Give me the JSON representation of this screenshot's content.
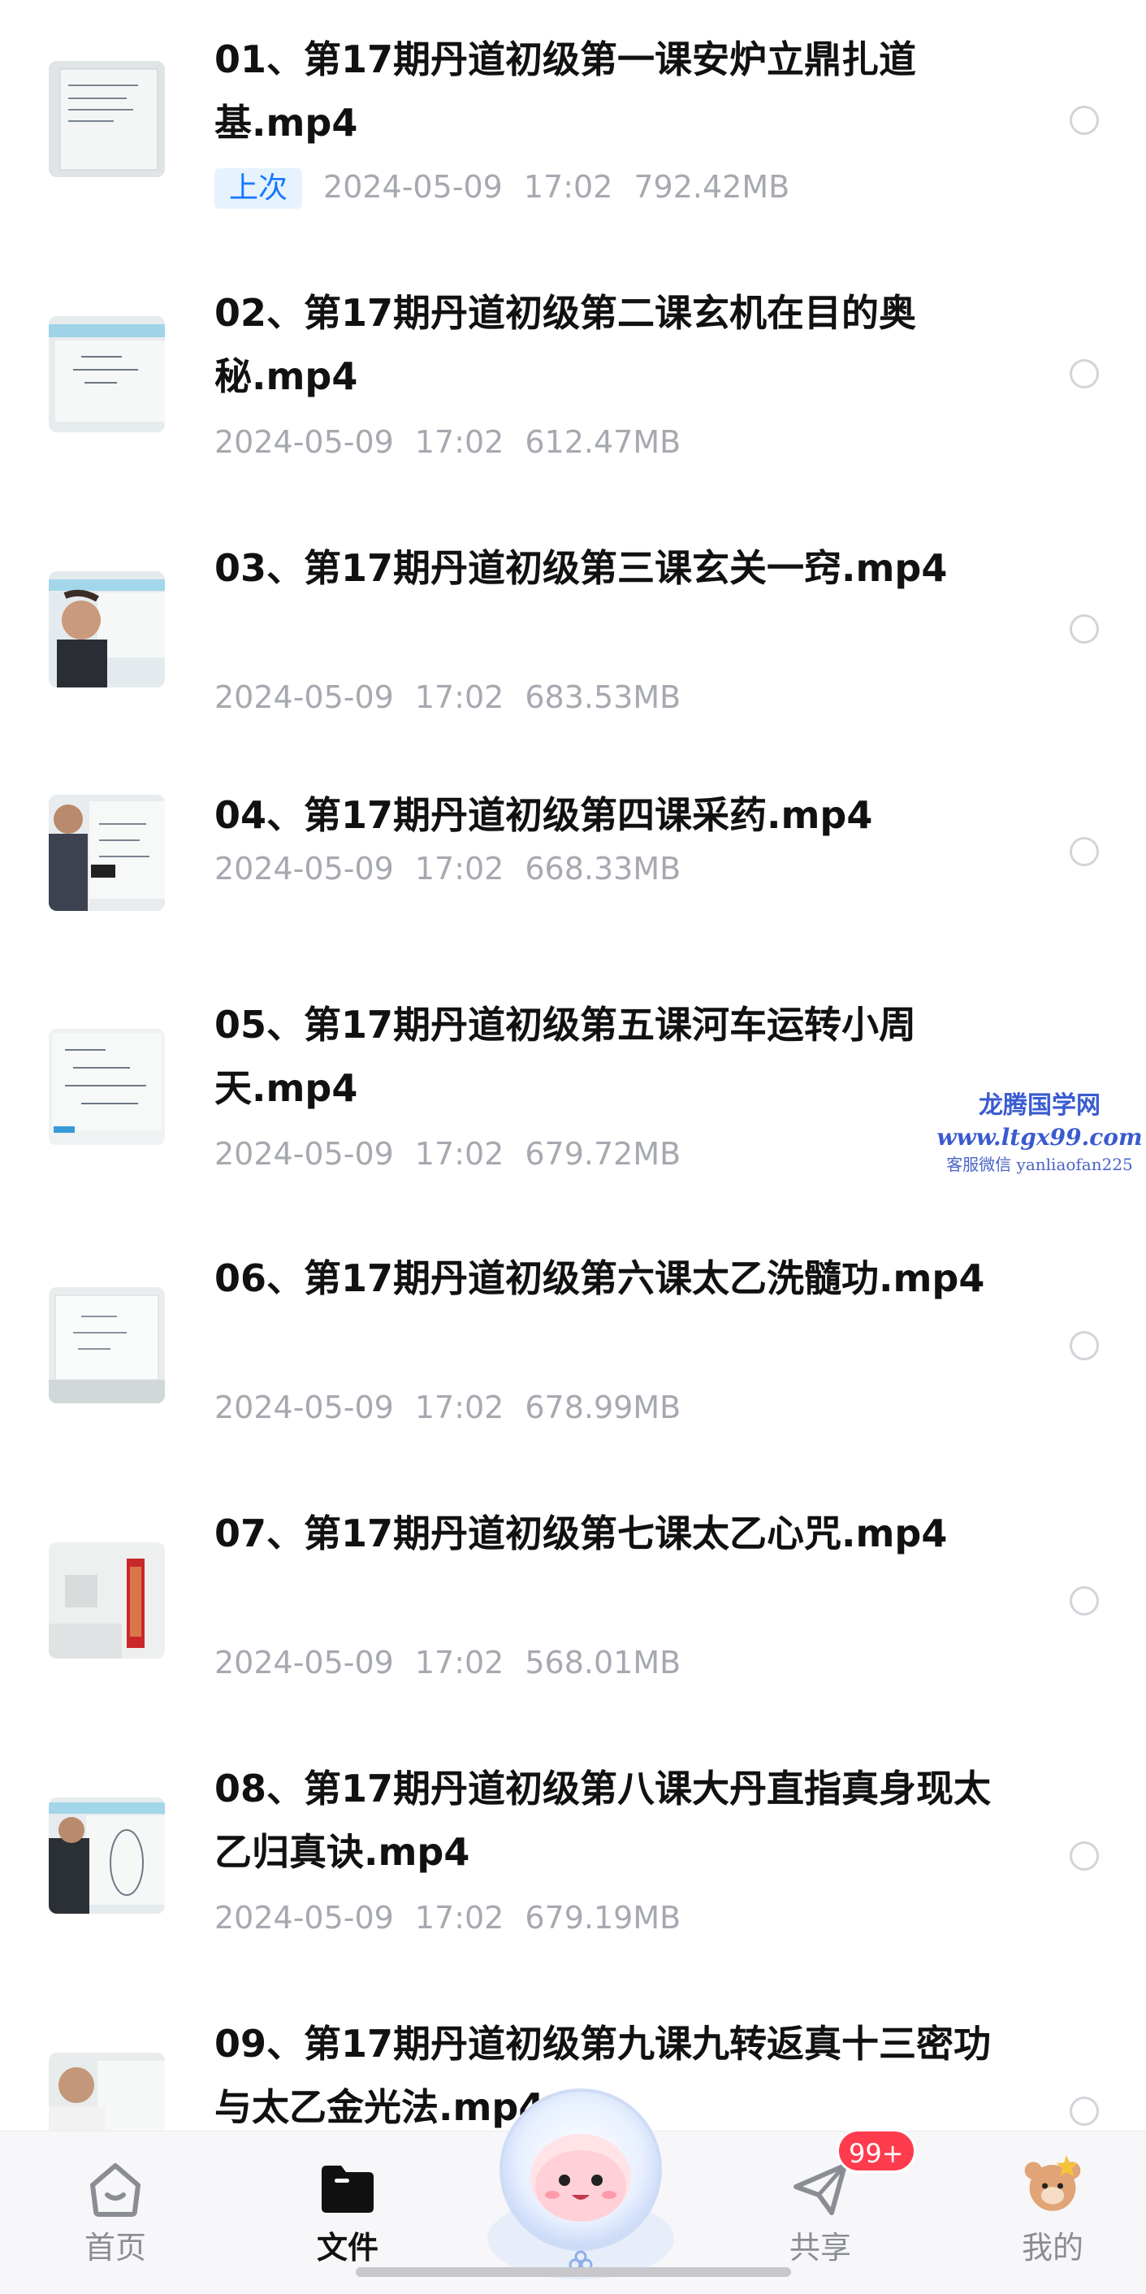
{
  "files": [
    {
      "title": "01、第17期丹道初级第一课安炉立鼎扎道基.mp4",
      "tag": "上次",
      "date": "2024-05-09",
      "time": "17:02",
      "size": "792.42MB"
    },
    {
      "title": "02、第17期丹道初级第二课玄机在目的奥秘.mp4",
      "date": "2024-05-09",
      "time": "17:02",
      "size": "612.47MB"
    },
    {
      "title": "03、第17期丹道初级第三课玄关一窍.mp4",
      "date": "2024-05-09",
      "time": "17:02",
      "size": "683.53MB"
    },
    {
      "title": "04、第17期丹道初级第四课采药.mp4",
      "date": "2024-05-09",
      "time": "17:02",
      "size": "668.33MB"
    },
    {
      "title": "05、第17期丹道初级第五课河车运转小周天.mp4",
      "date": "2024-05-09",
      "time": "17:02",
      "size": "679.72MB"
    },
    {
      "title": "06、第17期丹道初级第六课太乙洗髓功.mp4",
      "date": "2024-05-09",
      "time": "17:02",
      "size": "678.99MB"
    },
    {
      "title": "07、第17期丹道初级第七课太乙心咒.mp4",
      "date": "2024-05-09",
      "time": "17:02",
      "size": "568.01MB"
    },
    {
      "title": "08、第17期丹道初级第八课大丹直指真身现太乙归真诀.mp4",
      "date": "2024-05-09",
      "time": "17:02",
      "size": "679.19MB"
    },
    {
      "title": "09、第17期丹道初级第九课九转返真十三密功与太乙金光",
      "title_tail": "法.mp4"
    }
  ],
  "watermark": {
    "line1": "龙腾国学网",
    "line2": "www.ltgx99.com",
    "line3": "客服微信 yanliaofan225"
  },
  "tabbar": {
    "home": "首页",
    "files": "文件",
    "share": "共享",
    "share_badge": "99+",
    "mine": "我的"
  },
  "colors": {
    "accent": "#1677ff",
    "badge": "#ff3b4e",
    "meta_text": "#a6a9b0"
  },
  "icons": [
    "home-icon",
    "folder-icon",
    "assistant-mascot",
    "paper-plane-icon",
    "profile-avatar-icon",
    "selection-radio-icon"
  ]
}
